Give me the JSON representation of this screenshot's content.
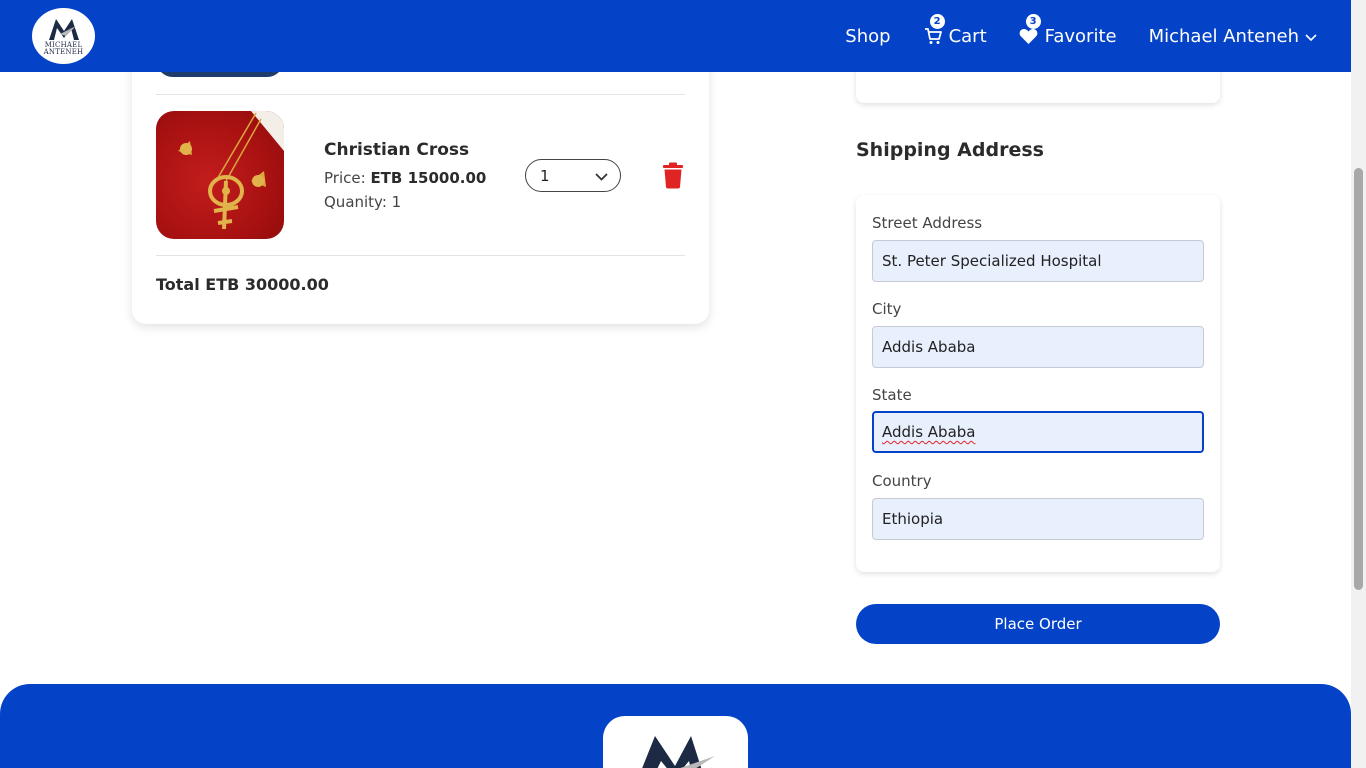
{
  "header": {
    "logo_text_line1": "MICHAEL",
    "logo_text_line2": "ANTENEH",
    "nav": {
      "shop_label": "Shop",
      "cart_label": "Cart",
      "cart_count": "2",
      "favorite_label": "Favorite",
      "favorite_count": "3",
      "user_name": "Michael Anteneh"
    }
  },
  "cart": {
    "items": [
      {
        "name": "Christian Cross",
        "price_label": "Price:",
        "price_value": "ETB 15000.00",
        "quantity_label": "Quanity: 1",
        "quantity_selected": "1"
      }
    ],
    "total": "Total ETB 30000.00"
  },
  "shipping": {
    "title": "Shipping Address",
    "street_label": "Street Address",
    "street_value": "St. Peter Specialized Hospital",
    "city_label": "City",
    "city_value": "Addis Ababa",
    "state_label": "State",
    "state_value": "Addis Ababa",
    "country_label": "Country",
    "country_value": "Ethiopia"
  },
  "actions": {
    "place_order": "Place Order"
  },
  "colors": {
    "brand_blue": "#0443c7",
    "delete_red": "#e02424",
    "input_bg": "#e8f0fe"
  },
  "icons": [
    "cart-icon",
    "heart-icon",
    "chevron-down-icon",
    "trash-icon"
  ]
}
